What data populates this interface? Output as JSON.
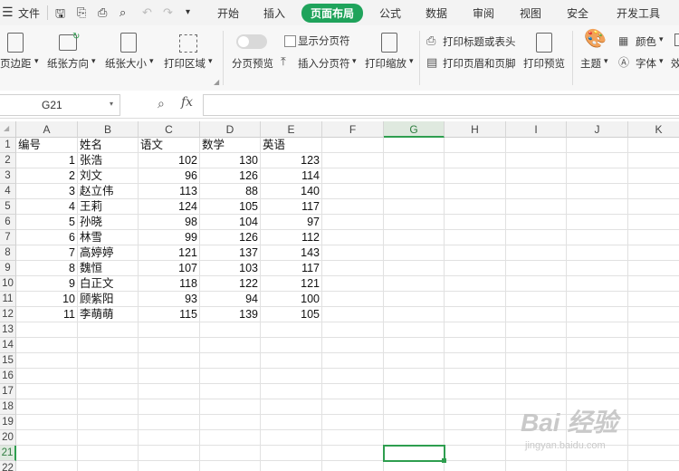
{
  "menubar": {
    "menu_icon": "hamburger-icon",
    "file": "文件",
    "tabs": [
      "开始",
      "插入",
      "页面布局",
      "公式",
      "数据",
      "审阅",
      "视图",
      "安全",
      "开发工具"
    ],
    "active_tab": "页面布局"
  },
  "toolbar": {
    "margins": "页边距",
    "orientation": "纸张方向",
    "paper_size": "纸张大小",
    "print_area": "打印区域",
    "page_break_preview": "分页预览",
    "show_page_breaks": "显示分页符",
    "insert_page_break": "插入分页符",
    "print_scaling": "打印缩放",
    "print_titles": "打印标题或表头",
    "print_header_footer": "打印页眉和页脚",
    "print_preview": "打印预览",
    "theme": "主题",
    "colors": "颜色",
    "fonts": "字体",
    "effects": "效"
  },
  "formula_bar": {
    "name_box": "G21",
    "fx": "fx",
    "value": ""
  },
  "sheet": {
    "columns": [
      "A",
      "B",
      "C",
      "D",
      "E",
      "F",
      "G",
      "H",
      "I",
      "J",
      "K"
    ],
    "rows": [
      "1",
      "2",
      "3",
      "4",
      "5",
      "6",
      "7",
      "8",
      "9",
      "10",
      "11",
      "12",
      "13",
      "14",
      "15",
      "16",
      "17",
      "18",
      "19",
      "20",
      "21",
      "22"
    ],
    "selected_cell": "G21",
    "headers": [
      "编号",
      "姓名",
      "语文",
      "数学",
      "英语"
    ],
    "data": [
      [
        "1",
        "张浩",
        "102",
        "130",
        "123"
      ],
      [
        "2",
        "刘文",
        "96",
        "126",
        "114"
      ],
      [
        "3",
        "赵立伟",
        "113",
        "88",
        "140"
      ],
      [
        "4",
        "王莉",
        "124",
        "105",
        "117"
      ],
      [
        "5",
        "孙晓",
        "98",
        "104",
        "97"
      ],
      [
        "6",
        "林雪",
        "99",
        "126",
        "112"
      ],
      [
        "7",
        "高婷婷",
        "121",
        "137",
        "143"
      ],
      [
        "8",
        "魏恒",
        "107",
        "103",
        "117"
      ],
      [
        "9",
        "白正文",
        "118",
        "122",
        "121"
      ],
      [
        "10",
        "顾紫阳",
        "93",
        "94",
        "100"
      ],
      [
        "11",
        "李萌萌",
        "115",
        "139",
        "105"
      ]
    ]
  },
  "watermark": {
    "text": "Bai 经验",
    "url": "jingyan.baidu.com"
  },
  "colors": {
    "accent": "#1fa35b",
    "selection": "#2e9e4f"
  }
}
